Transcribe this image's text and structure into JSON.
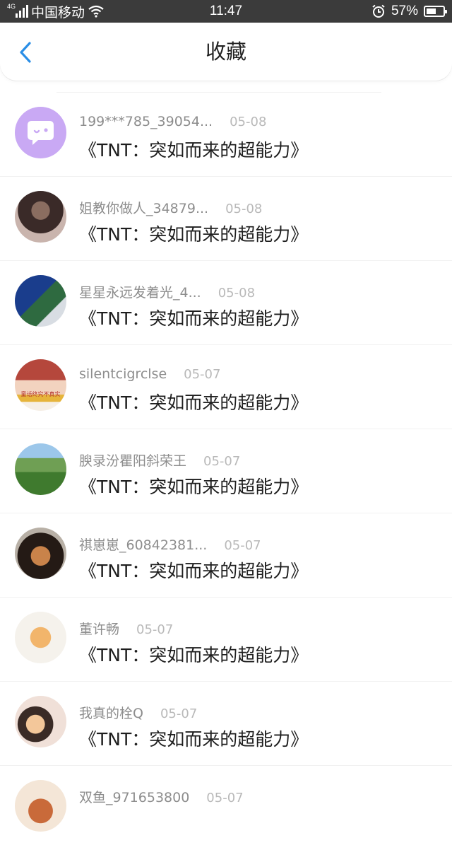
{
  "status_bar": {
    "network": "4G",
    "carrier": "中国移动",
    "time": "11:47",
    "battery_text": "57%",
    "battery_level": 0.57
  },
  "header": {
    "title": "收藏"
  },
  "items": [
    {
      "name": "199***785_39054...",
      "date": "05-08",
      "content": "《TNT：突如而来的超能力》",
      "avatar": "wechat-bubble"
    },
    {
      "name": "姐教你做人_34879...",
      "date": "05-08",
      "content": "《TNT：突如而来的超能力》",
      "avatar": "photo"
    },
    {
      "name": "星星永远发着光_4...",
      "date": "05-08",
      "content": "《TNT：突如而来的超能力》",
      "avatar": "photo"
    },
    {
      "name": "silentcigrclse",
      "date": "05-07",
      "content": "《TNT：突如而来的超能力》",
      "avatar": "photo",
      "avatar_text": "童话终究不真实"
    },
    {
      "name": "腴录汾瞿阳斜荣王",
      "date": "05-07",
      "content": "《TNT：突如而来的超能力》",
      "avatar": "photo"
    },
    {
      "name": "祺崽崽_60842381...",
      "date": "05-07",
      "content": "《TNT：突如而来的超能力》",
      "avatar": "photo"
    },
    {
      "name": "董许畅",
      "date": "05-07",
      "content": "《TNT：突如而来的超能力》",
      "avatar": "photo"
    },
    {
      "name": "我真的栓Q",
      "date": "05-07",
      "content": "《TNT：突如而来的超能力》",
      "avatar": "photo"
    },
    {
      "name": "双鱼_971653800",
      "date": "05-07",
      "content": "",
      "avatar": "photo"
    }
  ]
}
